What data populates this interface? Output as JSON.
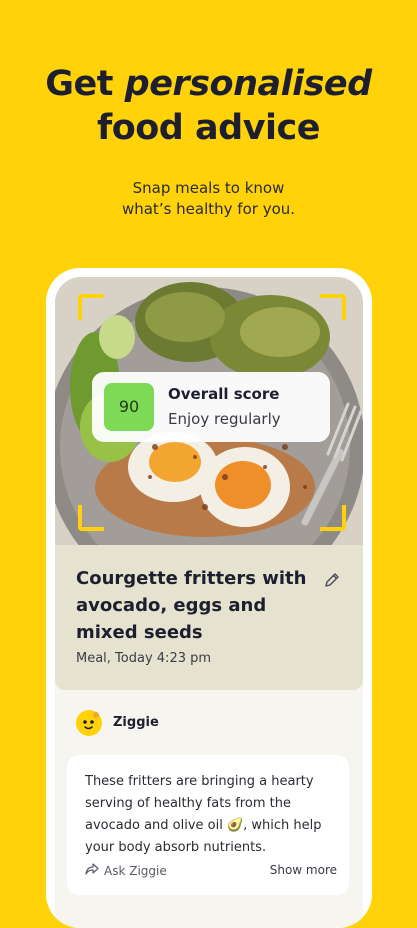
{
  "headline": {
    "line1_prefix": "Get ",
    "line1_emphasis": "personalised",
    "line2": "food advice"
  },
  "subline": {
    "line1": "Snap meals to know",
    "line2": "what’s healthy for you."
  },
  "score_card": {
    "score": "90",
    "title": "Overall score",
    "verdict": "Enjoy regularly",
    "score_color": "#7ED957"
  },
  "meal": {
    "title": "Courgette fritters with avocado, eggs and mixed seeds",
    "meta": "Meal, Today 4:23 pm"
  },
  "assistant": {
    "name": "Ziggie",
    "message": "These fritters are bringing a hearty serving of healthy fats from the avocado and olive oil 🥑, which help your body absorb nutrients.",
    "ask_label": "Ask Ziggie",
    "show_more_label": "Show more"
  },
  "colors": {
    "background": "#FFD20A",
    "meal_card": "#E5E2D0",
    "screen": "#F7F5EF"
  },
  "icons": [
    "edit-pencil-icon",
    "share-arrow-icon",
    "ziggie-avatar-icon"
  ]
}
